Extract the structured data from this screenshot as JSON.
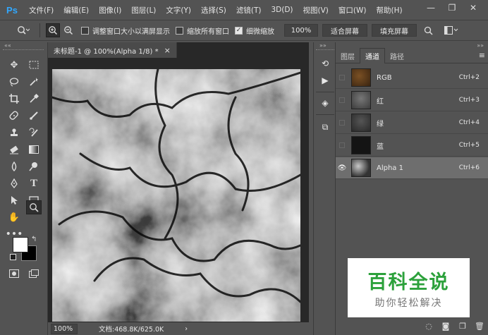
{
  "app": {
    "logo": "Ps"
  },
  "menu": [
    "文件(F)",
    "编辑(E)",
    "图像(I)",
    "图层(L)",
    "文字(Y)",
    "选择(S)",
    "滤镜(T)",
    "3D(D)",
    "视图(V)",
    "窗口(W)",
    "帮助(H)"
  ],
  "options": {
    "resize_windows_label": "调整窗口大小以满屏显示",
    "zoom_all_label": "缩放所有窗口",
    "scrubby_zoom_label": "细微缩放",
    "zoom_percent": "100%",
    "fit_screen": "适合屏幕",
    "fill_screen": "填充屏幕"
  },
  "document": {
    "tab_title": "未标题-1 @ 100%(Alpha 1/8) *",
    "close_symbol": "×",
    "zoom": "100%",
    "doc_info": "文档:468.8K/625.0K",
    "nav_arrow": "›"
  },
  "panel": {
    "tabs": [
      "图层",
      "通道",
      "路径"
    ],
    "active_tab": "通道",
    "channels": [
      {
        "name": "RGB",
        "shortcut": "Ctrl+2",
        "thumb_color": "#5a3a18",
        "visible": false,
        "selected": false
      },
      {
        "name": "红",
        "shortcut": "Ctrl+3",
        "thumb_color": "#5c5c5c",
        "visible": false,
        "selected": false
      },
      {
        "name": "绿",
        "shortcut": "Ctrl+4",
        "thumb_color": "#444444",
        "visible": false,
        "selected": false
      },
      {
        "name": "蓝",
        "shortcut": "Ctrl+5",
        "thumb_color": "#161616",
        "visible": false,
        "selected": false
      },
      {
        "name": "Alpha 1",
        "shortcut": "Ctrl+6",
        "thumb_color": "#888888",
        "visible": true,
        "selected": true
      }
    ]
  },
  "watermark": {
    "title": "百科全说",
    "subtitle": "助你轻松解决"
  },
  "colors": {
    "accent": "#31a8ff",
    "watermark_green": "#2ca13b"
  }
}
